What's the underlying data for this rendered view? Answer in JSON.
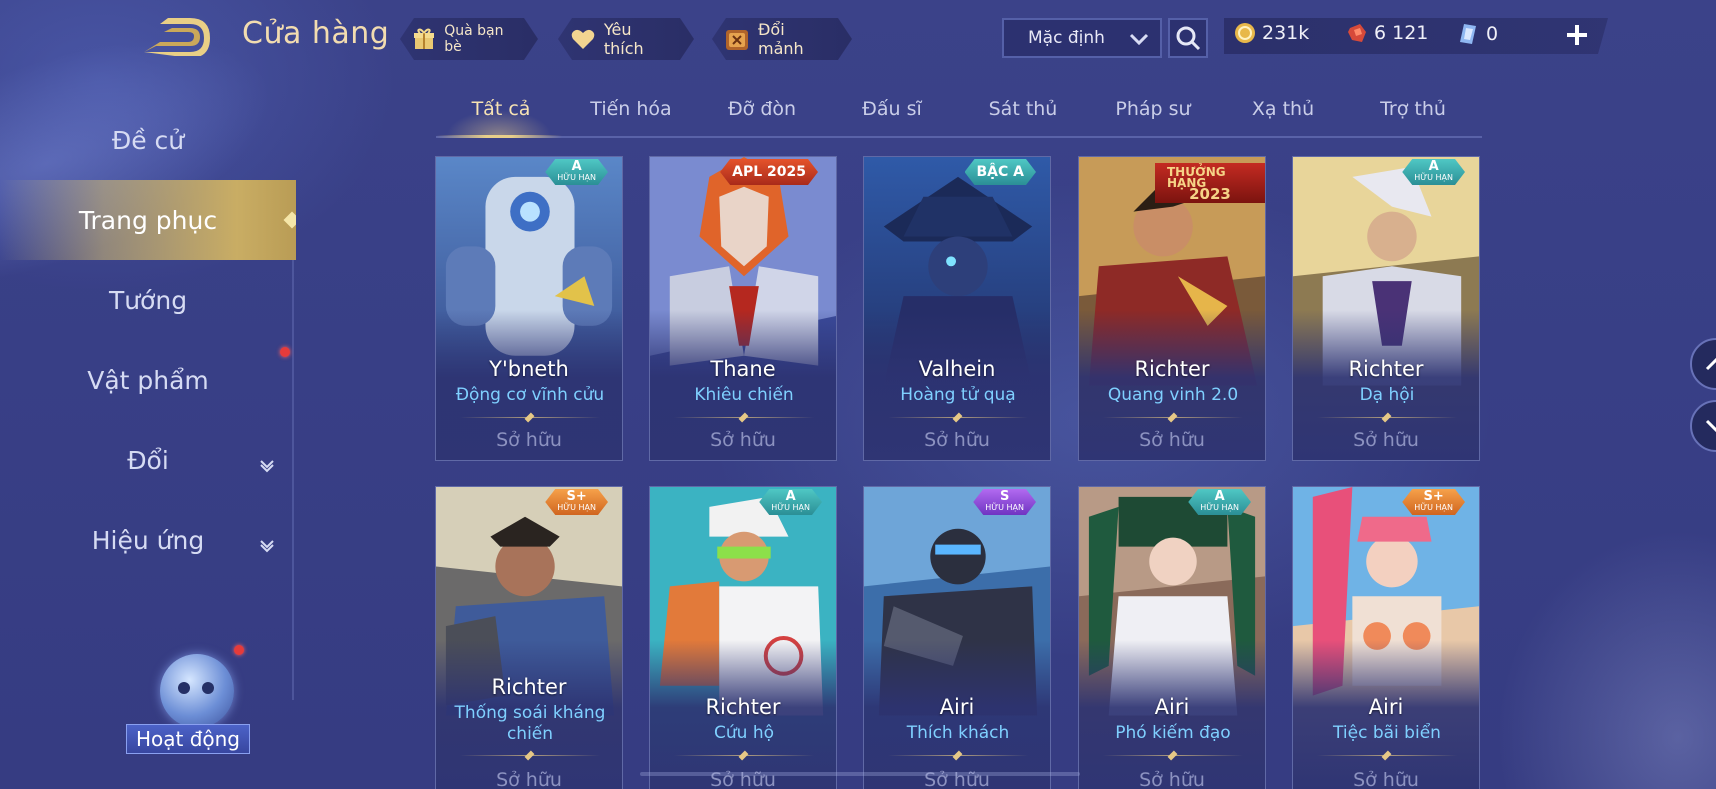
{
  "header": {
    "title": "Cửa hàng",
    "gift_label": "Quà bạn bè",
    "favorite_label": "Yêu thích",
    "exchange_label": "Đổi mảnh",
    "sort_value": "Mặc định",
    "currency": [
      {
        "icon": "gold-coin-icon",
        "value": "231k"
      },
      {
        "icon": "red-voucher-icon",
        "value": "6 121"
      },
      {
        "icon": "blue-crystal-icon",
        "value": "0"
      }
    ]
  },
  "sidebar": {
    "items": [
      {
        "label": "Đề cử"
      },
      {
        "label": "Trang phục"
      },
      {
        "label": "Tướng"
      },
      {
        "label": "Vật phẩm"
      },
      {
        "label": "Đổi"
      },
      {
        "label": "Hiệu ứng"
      }
    ],
    "activity_label": "Hoạt động"
  },
  "tabs": [
    "Tất cả",
    "Tiến hóa",
    "Đỡ đòn",
    "Đấu sĩ",
    "Sát thủ",
    "Pháp sư",
    "Xạ thủ",
    "Trợ thủ"
  ],
  "cards": [
    {
      "hero": "Y'bneth",
      "skin": "Động cơ vĩnh cửu",
      "status": "Sở hữu",
      "badge": "A",
      "badge_sub": "HỮU HẠN"
    },
    {
      "hero": "Thane",
      "skin": "Khiêu chiến",
      "status": "Sở hữu",
      "badge": "APL 2025",
      "badge_sub": ""
    },
    {
      "hero": "Valhein",
      "skin": "Hoàng tử quạ",
      "status": "Sở hữu",
      "badge": "BẬC A",
      "badge_sub": ""
    },
    {
      "hero": "Richter",
      "skin": "Quang vinh 2.0",
      "status": "Sở hữu",
      "badge": "THƯỞNG HẠNG",
      "badge_sub": "2023"
    },
    {
      "hero": "Richter",
      "skin": "Dạ hội",
      "status": "Sở hữu",
      "badge": "A",
      "badge_sub": "HỮU HẠN"
    },
    {
      "hero": "Richter",
      "skin": "Thống soái kháng chiến",
      "status": "Sở hữu",
      "badge": "S+",
      "badge_sub": "HỮU HẠN"
    },
    {
      "hero": "Richter",
      "skin": "Cứu hộ",
      "status": "Sở hữu",
      "badge": "A",
      "badge_sub": "HỮU HẠN"
    },
    {
      "hero": "Airi",
      "skin": "Thích khách",
      "status": "Sở hữu",
      "badge": "S",
      "badge_sub": "HỮU HẠN"
    },
    {
      "hero": "Airi",
      "skin": "Phó kiếm đạo",
      "status": "Sở hữu",
      "badge": "A",
      "badge_sub": "HỮU HẠN"
    },
    {
      "hero": "Airi",
      "skin": "Tiệc bãi biển",
      "status": "Sở hữu",
      "badge": "S+",
      "badge_sub": "HỮU HẠN"
    }
  ],
  "colors": {
    "accent_gold": "#e8cf8a",
    "skin_name": "#7fd0ff",
    "background": "#3a3f80"
  }
}
